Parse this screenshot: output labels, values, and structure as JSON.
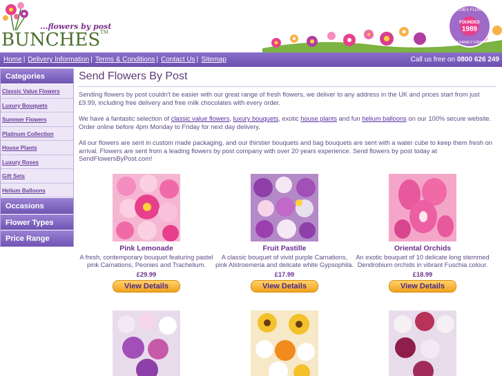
{
  "header": {
    "tagline": "...flowers by post",
    "brand": "BUNCHES",
    "brand_tm": "TM",
    "badge_top": "BUNCHES FLORISTS",
    "badge_mid": "FOUNDED",
    "badge_year": "1989",
    "badge_bottom": "A FAMILY FIRM"
  },
  "nav": {
    "links": [
      "Home",
      "Delivery Information",
      "Terms & Conditions",
      "Contact Us",
      "Sitemap"
    ],
    "call_prefix": "Call us free on",
    "phone": "0800 626 249"
  },
  "sidebar": {
    "categories_label": "Categories",
    "items": [
      "Classic Value Flowers",
      "Luxury Bouquets",
      "Summer Flowers",
      "Platinum Collection",
      "House Plants",
      "Luxury Roses",
      "Gift Sets",
      "Helium Balloons"
    ],
    "sections": [
      "Occasions",
      "Flower Types",
      "Price Range"
    ]
  },
  "main": {
    "title": "Send Flowers By Post",
    "p1": "Sending flowers by post couldn't be easier with our great range of fresh flowers, we deliver to any address in the UK and prices start from just £9.99, including free delivery and free milk chocolates with every order.",
    "p2_a": "We have a fantastic selection of ",
    "p2_link1": "classic value flowers",
    "p2_b": ", ",
    "p2_link2": "luxury bouquets",
    "p2_c": ", exotic ",
    "p2_link3": "house plants",
    "p2_d": " and fun ",
    "p2_link4": "helium balloons",
    "p2_e": " on our 100% secure website. Order online before 4pm Monday to Friday for next day delivery.",
    "p3": "All our flowers are sent in custom made packaging, and our thirstier bouquets and bag bouquets are sent with a water cube to keep them fresh on arrival. Flowers are sent from a leading flowers by post company with over 20 years experience. Send flowers by post today at SendFlowersByPost.com!"
  },
  "products": [
    {
      "name": "Pink Lemonade",
      "desc": "A fresh, contemporary bouquet featuring pastel pink Carnations, Peonies and Trachelium.",
      "price": "£29.99",
      "button": "View Details"
    },
    {
      "name": "Fruit Pastille",
      "desc": "A classic bouquet of vivid purple Carnations, pink Alstroemeria and delicate white Gypsophila.",
      "price": "£17.99",
      "button": "View Details"
    },
    {
      "name": "Oriental Orchids",
      "desc": "An exotic bouquet of 10 delicate long stemmed Dendrobium orchids in vibrant Fuschia colour.",
      "price": "£18.99",
      "button": "View Details"
    }
  ],
  "colors": {
    "nav_purple": "#7a5fbe",
    "text_purple": "#5d4a86",
    "button_orange": "#f1a11e"
  }
}
